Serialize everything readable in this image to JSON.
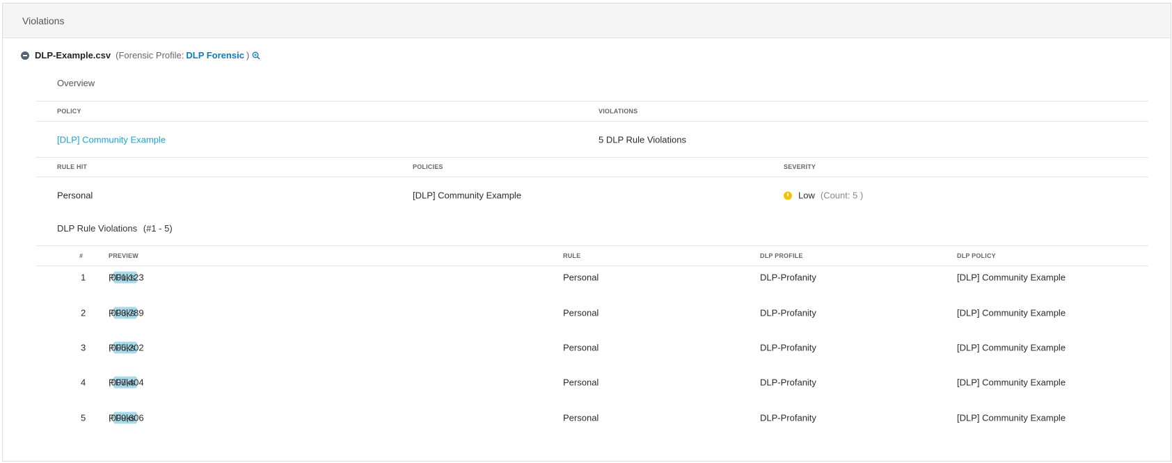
{
  "header": {
    "title": "Violations"
  },
  "file": {
    "name": "DLP-Example.csv",
    "forensic_prefix": "(Forensic Profile:",
    "forensic_profile": "DLP Forensic",
    "forensic_suffix": ")"
  },
  "overview": {
    "title": "Overview",
    "columns": {
      "policy": "POLICY",
      "violations": "VIOLATIONS"
    },
    "policy": "[DLP] Community Example",
    "violations": "5 DLP Rule Violations"
  },
  "rule_summary": {
    "columns": {
      "rule_hit": "RULE HIT",
      "policies": "POLICIES",
      "severity": "SEVERITY"
    },
    "rule_hit": "Personal",
    "policies": "[DLP] Community Example",
    "severity": "Low",
    "count": "(Count: 5 )",
    "severity_color": "#f5c400"
  },
  "violations_table": {
    "title": "DLP Rule Violations",
    "range": "(#1 - 5)",
    "columns": {
      "num": "#",
      "preview": "PREVIEW",
      "rule": "RULE",
      "dlp_profile": "DLP PROFILE",
      "dlp_policy": "DLP POLICY"
    },
    "rows": [
      {
        "num": "1",
        "pre": "Peter,",
        "match": "Fuks",
        "post": ",001,123",
        "rule": "Personal",
        "profile": "DLP-Profanity",
        "policy": "[DLP] Community Example"
      },
      {
        "num": "2",
        "pre": "Peter,",
        "match": "Fuks",
        "post": ",003,789",
        "rule": "Personal",
        "profile": "DLP-Profanity",
        "policy": "[DLP] Community Example"
      },
      {
        "num": "3",
        "pre": "Peter,",
        "match": "Fuks",
        "post": ",005,202",
        "rule": "Personal",
        "profile": "DLP-Profanity",
        "policy": "[DLP] Community Example"
      },
      {
        "num": "4",
        "pre": "Peter,",
        "match": "Fuks",
        "post": ",007,404",
        "rule": "Personal",
        "profile": "DLP-Profanity",
        "policy": "[DLP] Community Example"
      },
      {
        "num": "5",
        "pre": "Peter,",
        "match": "Fuks",
        "post": ",009,606",
        "rule": "Personal",
        "profile": "DLP-Profanity",
        "policy": "[DLP] Community Example"
      }
    ]
  },
  "colors": {
    "link": "#1aa3d6",
    "link_dark": "#0b7bbd",
    "highlight": "#a8dbe9"
  }
}
